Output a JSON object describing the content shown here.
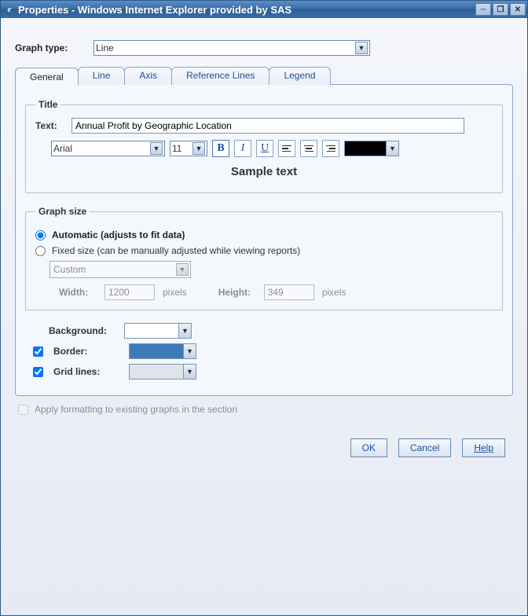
{
  "window": {
    "title": "Properties - Windows Internet Explorer provided by SAS"
  },
  "graphType": {
    "label": "Graph type:",
    "value": "Line"
  },
  "tabs": {
    "general": "General",
    "line": "Line",
    "axis": "Axis",
    "refLines": "Reference Lines",
    "legend": "Legend"
  },
  "titleSection": {
    "legend": "Title",
    "textLabel": "Text:",
    "textValue": "Annual Profit by Geographic Location",
    "fontName": "Arial",
    "fontSize": "11",
    "bold": "B",
    "italic": "I",
    "underline": "U",
    "sample": "Sample text"
  },
  "graphSize": {
    "legend": "Graph size",
    "auto": "Automatic (adjusts to fit data)",
    "fixed": "Fixed size (can be manually adjusted while viewing reports)",
    "custom": "Custom",
    "widthLabel": "Width:",
    "widthValue": "1200",
    "heightLabel": "Height:",
    "heightValue": "349",
    "pixels": "pixels"
  },
  "visual": {
    "backgroundLabel": "Background:",
    "borderLabel": "Border:",
    "gridLabel": "Grid lines:"
  },
  "applyFormatting": "Apply formatting to existing graphs in the section",
  "buttons": {
    "ok": "OK",
    "cancel": "Cancel",
    "help": "Help"
  }
}
